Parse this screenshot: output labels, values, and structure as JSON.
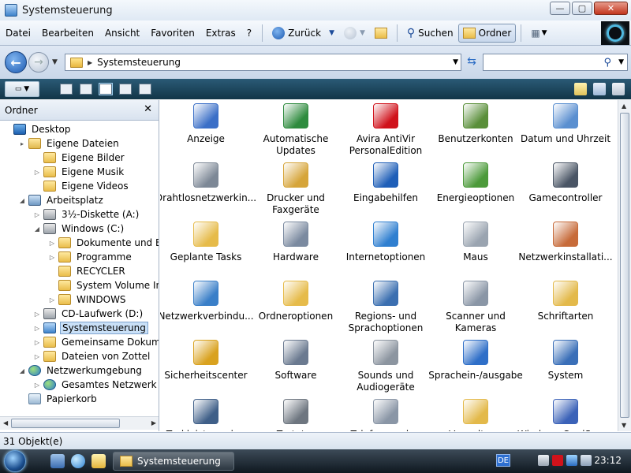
{
  "window": {
    "title": "Systemsteuerung",
    "controls": {
      "minimize": "—",
      "maximize": "▢",
      "close": "✕"
    }
  },
  "menu": {
    "items": [
      "Datei",
      "Bearbeiten",
      "Ansicht",
      "Favoriten",
      "Extras",
      "?"
    ],
    "back_label": "Zurück",
    "search_label": "Suchen",
    "folders_label": "Ordner"
  },
  "address": {
    "path": "Systemsteuerung",
    "search_placeholder": ""
  },
  "folder_pane": {
    "title": "Ordner",
    "tree": [
      {
        "label": "Desktop",
        "icon": "desktop-icon",
        "depth": 0,
        "exp": ""
      },
      {
        "label": "Eigene Dateien",
        "icon": "documents-icon",
        "depth": 1,
        "exp": "▸"
      },
      {
        "label": "Eigene Bilder",
        "icon": "folder-icon",
        "depth": 2,
        "exp": ""
      },
      {
        "label": "Eigene Musik",
        "icon": "folder-icon",
        "depth": 2,
        "exp": "▷"
      },
      {
        "label": "Eigene Videos",
        "icon": "folder-icon",
        "depth": 2,
        "exp": ""
      },
      {
        "label": "Arbeitsplatz",
        "icon": "computer-icon",
        "depth": 1,
        "exp": "◢"
      },
      {
        "label": "3½-Diskette (A:)",
        "icon": "floppy-icon",
        "depth": 2,
        "exp": "▷"
      },
      {
        "label": "Windows (C:)",
        "icon": "drive-icon",
        "depth": 2,
        "exp": "◢"
      },
      {
        "label": "Dokumente und Einste",
        "icon": "folder-icon",
        "depth": 3,
        "exp": "▷"
      },
      {
        "label": "Programme",
        "icon": "folder-icon",
        "depth": 3,
        "exp": "▷"
      },
      {
        "label": "RECYCLER",
        "icon": "folder-icon",
        "depth": 3,
        "exp": ""
      },
      {
        "label": "System Volume Inform",
        "icon": "folder-icon",
        "depth": 3,
        "exp": ""
      },
      {
        "label": "WINDOWS",
        "icon": "folder-icon",
        "depth": 3,
        "exp": "▷"
      },
      {
        "label": "CD-Laufwerk (D:)",
        "icon": "cd-drive-icon",
        "depth": 2,
        "exp": "▷"
      },
      {
        "label": "Systemsteuerung",
        "icon": "control-panel-icon",
        "depth": 2,
        "exp": "▷",
        "selected": true
      },
      {
        "label": "Gemeinsame Dokumente",
        "icon": "folder-icon",
        "depth": 2,
        "exp": "▷"
      },
      {
        "label": "Dateien von Zottel",
        "icon": "folder-icon",
        "depth": 2,
        "exp": "▷"
      },
      {
        "label": "Netzwerkumgebung",
        "icon": "network-icon",
        "depth": 1,
        "exp": "◢"
      },
      {
        "label": "Gesamtes Netzwerk",
        "icon": "globe-icon",
        "depth": 2,
        "exp": "▷"
      },
      {
        "label": "Papierkorb",
        "icon": "recycle-bin-icon",
        "depth": 1,
        "exp": ""
      }
    ]
  },
  "items": [
    {
      "label": "Anzeige",
      "icon": "display-icon",
      "color": "#3b6fc7"
    },
    {
      "label": "Automatische Updates",
      "icon": "windows-update-icon",
      "color": "#2e8b3e"
    },
    {
      "label": "Avira AntiVir PersonalEdition",
      "icon": "avira-icon",
      "color": "#d0121b"
    },
    {
      "label": "Benutzerkonten",
      "icon": "user-accounts-icon",
      "color": "#5a8f3a"
    },
    {
      "label": "Datum und Uhrzeit",
      "icon": "date-time-icon",
      "color": "#5a8fd0"
    },
    {
      "label": "Drahtlosnetzwerkin...",
      "icon": "wireless-setup-icon",
      "color": "#7d8896"
    },
    {
      "label": "Drucker und Faxgeräte",
      "icon": "printers-icon",
      "color": "#d6a53a"
    },
    {
      "label": "Eingabehilfen",
      "icon": "accessibility-icon",
      "color": "#1f5fb8"
    },
    {
      "label": "Energieoptionen",
      "icon": "power-options-icon",
      "color": "#4c9a3a"
    },
    {
      "label": "Gamecontroller",
      "icon": "game-controller-icon",
      "color": "#4a5565"
    },
    {
      "label": "Geplante Tasks",
      "icon": "scheduled-tasks-icon",
      "color": "#e6bb4a"
    },
    {
      "label": "Hardware",
      "icon": "hardware-icon",
      "color": "#7b8aa0"
    },
    {
      "label": "Internetoptionen",
      "icon": "internet-options-icon",
      "color": "#2f7fd0"
    },
    {
      "label": "Maus",
      "icon": "mouse-icon",
      "color": "#9aa4b0"
    },
    {
      "label": "Netzwerkinstallati...",
      "icon": "network-setup-icon",
      "color": "#c76b3a"
    },
    {
      "label": "Netzwerkverbindu...",
      "icon": "network-connections-icon",
      "color": "#3a7fc8"
    },
    {
      "label": "Ordneroptionen",
      "icon": "folder-options-icon",
      "color": "#e6bb4a"
    },
    {
      "label": "Regions- und Sprachoptionen",
      "icon": "regional-options-icon",
      "color": "#3b6fb0"
    },
    {
      "label": "Scanner und Kameras",
      "icon": "scanner-camera-icon",
      "color": "#8a96a6"
    },
    {
      "label": "Schriftarten",
      "icon": "fonts-icon",
      "color": "#e3b94a"
    },
    {
      "label": "Sicherheitscenter",
      "icon": "security-center-icon",
      "color": "#d9a21f"
    },
    {
      "label": "Software",
      "icon": "software-icon",
      "color": "#6b7a90"
    },
    {
      "label": "Sounds und Audiogeräte",
      "icon": "sounds-icon",
      "color": "#8c95a0"
    },
    {
      "label": "Sprachein-/ausgabe",
      "icon": "speech-icon",
      "color": "#2f6fc8"
    },
    {
      "label": "System",
      "icon": "system-icon",
      "color": "#3a6fb8"
    },
    {
      "label": "Taskleiste und ...",
      "icon": "taskbar-icon",
      "color": "#3f5f88"
    },
    {
      "label": "Tastatur",
      "icon": "keyboard-icon",
      "color": "#6e7680"
    },
    {
      "label": "Telefon- und ...",
      "icon": "phone-modem-icon",
      "color": "#8a96a6"
    },
    {
      "label": "Verwaltung",
      "icon": "admin-tools-icon",
      "color": "#e3b94a"
    },
    {
      "label": "Windows CardSpace",
      "icon": "cardspace-icon",
      "color": "#3b62b8"
    }
  ],
  "status": {
    "text": "31 Objekt(e)"
  },
  "taskbar": {
    "task_label": "Systemsteuerung",
    "language": "DE",
    "time": "23:12"
  }
}
